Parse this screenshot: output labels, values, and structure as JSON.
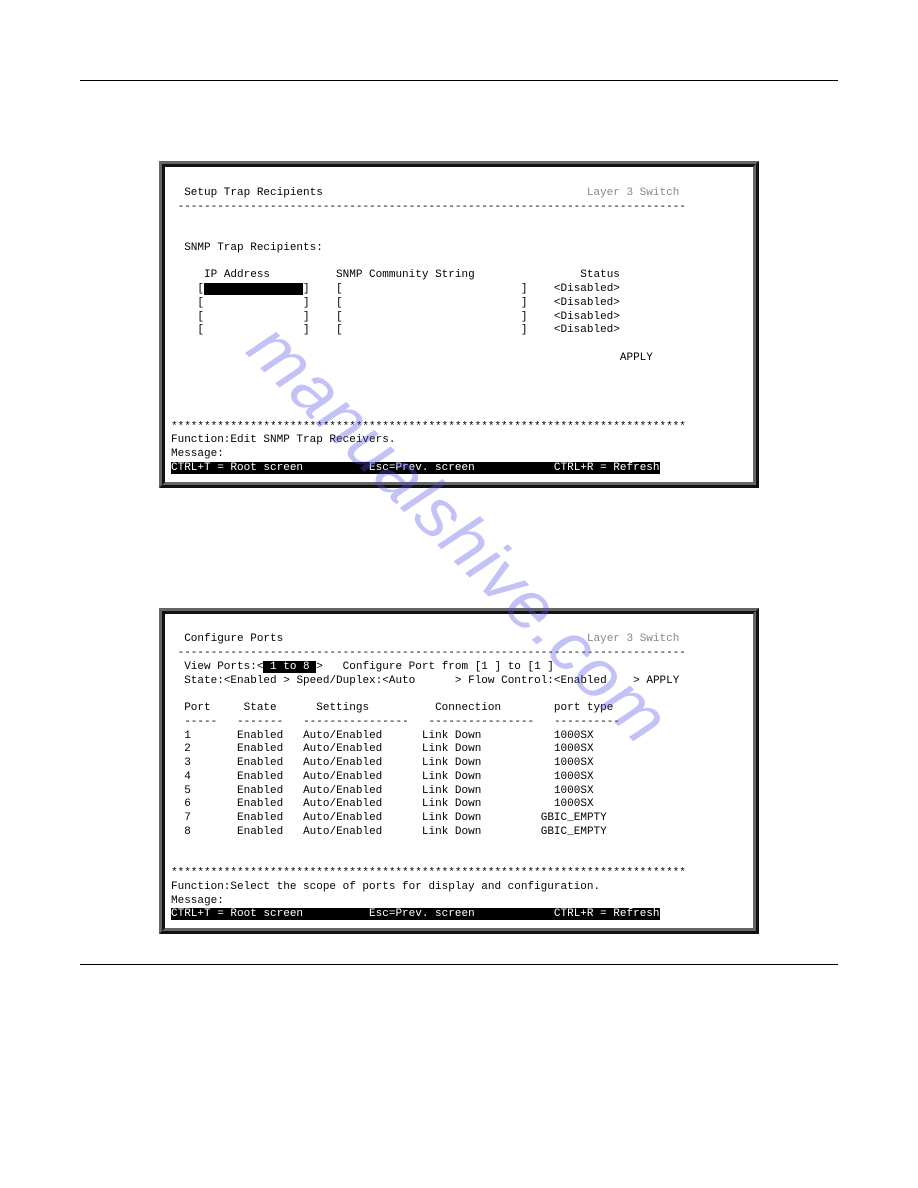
{
  "watermark": "manualshive.com",
  "screen1": {
    "title_left": "Setup Trap Recipients",
    "title_right": "Layer 3 Switch",
    "dash_line": "-----------------------------------------------------------------------------",
    "section_label": "SNMP Trap Recipients:",
    "col_ip": "IP Address",
    "col_comm": "SNMP Community String",
    "col_status": "Status",
    "rows": [
      {
        "ip": "",
        "comm": "",
        "status": "<Disabled>",
        "selected": true
      },
      {
        "ip": "",
        "comm": "",
        "status": "<Disabled>",
        "selected": false
      },
      {
        "ip": "",
        "comm": "",
        "status": "<Disabled>",
        "selected": false
      },
      {
        "ip": "",
        "comm": "",
        "status": "<Disabled>",
        "selected": false
      }
    ],
    "apply_label": "APPLY",
    "star_line": "******************************************************************************",
    "function_line": "Function:Edit SNMP Trap Receivers.",
    "message_line": "Message:",
    "footer_left": "CTRL+T = Root screen",
    "footer_mid": "Esc=Prev. screen",
    "footer_right": "CTRL+R = Refresh"
  },
  "screen2": {
    "title_left": "Configure Ports",
    "title_right": "Layer 3 Switch",
    "dash_line": "-----------------------------------------------------------------------------",
    "view_ports_label": "View Ports:",
    "view_ports_value": "1 to 8",
    "config_label": "Configure Port from [1 ] to [1 ]",
    "state_label": "State:",
    "state_value": "<Enabled >",
    "speed_label": "Speed/Duplex:",
    "speed_value": "<Auto      >",
    "flow_label": "Flow Control:",
    "flow_value": "<Enabled    >",
    "apply_label": "APPLY",
    "table_headers": {
      "port": "Port",
      "state": "State",
      "settings": "Settings",
      "connection": "Connection",
      "type": "port type"
    },
    "header_dashes": {
      "port": "-----",
      "state": "-------",
      "settings": "----------------",
      "connection": "----------------",
      "type": "----------"
    },
    "rows": [
      {
        "port": "1",
        "state": "Enabled",
        "settings": "Auto/Enabled",
        "connection": "Link Down",
        "type": "1000SX"
      },
      {
        "port": "2",
        "state": "Enabled",
        "settings": "Auto/Enabled",
        "connection": "Link Down",
        "type": "1000SX"
      },
      {
        "port": "3",
        "state": "Enabled",
        "settings": "Auto/Enabled",
        "connection": "Link Down",
        "type": "1000SX"
      },
      {
        "port": "4",
        "state": "Enabled",
        "settings": "Auto/Enabled",
        "connection": "Link Down",
        "type": "1000SX"
      },
      {
        "port": "5",
        "state": "Enabled",
        "settings": "Auto/Enabled",
        "connection": "Link Down",
        "type": "1000SX"
      },
      {
        "port": "6",
        "state": "Enabled",
        "settings": "Auto/Enabled",
        "connection": "Link Down",
        "type": "1000SX"
      },
      {
        "port": "7",
        "state": "Enabled",
        "settings": "Auto/Enabled",
        "connection": "Link Down",
        "type": "GBIC_EMPTY"
      },
      {
        "port": "8",
        "state": "Enabled",
        "settings": "Auto/Enabled",
        "connection": "Link Down",
        "type": "GBIC_EMPTY"
      }
    ],
    "star_line": "******************************************************************************",
    "function_line": "Function:Select the scope of ports for display and configuration.",
    "message_line": "Message:",
    "footer_left": "CTRL+T = Root screen",
    "footer_mid": "Esc=Prev. screen",
    "footer_right": "CTRL+R = Refresh"
  }
}
